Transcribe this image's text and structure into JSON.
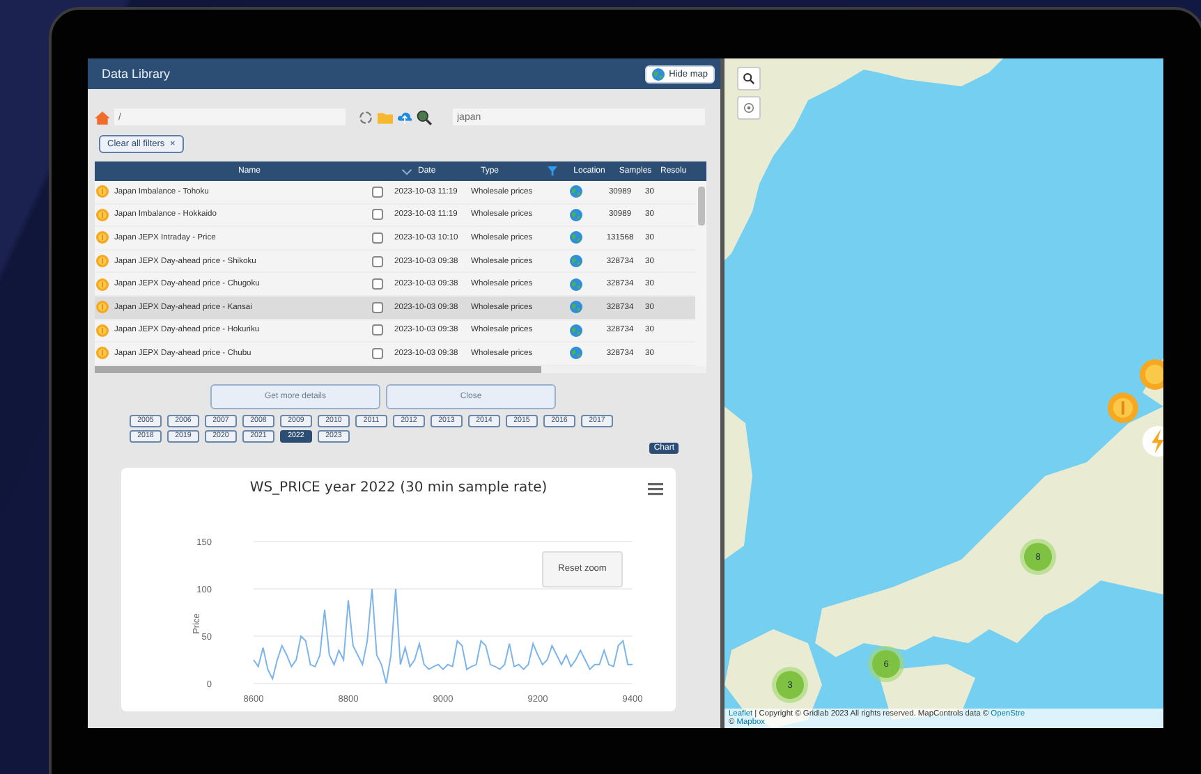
{
  "window": {
    "title": "Data Library"
  },
  "hide_map_button": {
    "label": "Hide map"
  },
  "path_field": {
    "value": "/"
  },
  "search_field": {
    "value": "japan"
  },
  "filter_chip": {
    "label": "Clear all filters",
    "close": "×"
  },
  "table": {
    "columns": [
      "Name",
      "Date",
      "Type",
      "Location",
      "Samples",
      "Resolu"
    ],
    "rows": [
      {
        "name": "Japan Imbalance - Tohoku",
        "checked": false,
        "date": "2023-10-03 11:19",
        "type": "Wholesale prices",
        "samples": "30989",
        "resolution": "30",
        "selected": false
      },
      {
        "name": "Japan Imbalance - Hokkaido",
        "checked": false,
        "date": "2023-10-03 11:19",
        "type": "Wholesale prices",
        "samples": "30989",
        "resolution": "30",
        "selected": false
      },
      {
        "name": "Japan JEPX Intraday - Price",
        "checked": false,
        "date": "2023-10-03 10:10",
        "type": "Wholesale prices",
        "samples": "131568",
        "resolution": "30",
        "selected": false
      },
      {
        "name": "Japan JEPX Day-ahead price - Shikoku",
        "checked": false,
        "date": "2023-10-03 09:38",
        "type": "Wholesale prices",
        "samples": "328734",
        "resolution": "30",
        "selected": false
      },
      {
        "name": "Japan JEPX Day-ahead price - Chugoku",
        "checked": false,
        "date": "2023-10-03 09:38",
        "type": "Wholesale prices",
        "samples": "328734",
        "resolution": "30",
        "selected": false
      },
      {
        "name": "Japan JEPX Day-ahead price - Kansai",
        "checked": false,
        "date": "2023-10-03 09:38",
        "type": "Wholesale prices",
        "samples": "328734",
        "resolution": "30",
        "selected": true
      },
      {
        "name": "Japan JEPX Day-ahead price - Hokuriku",
        "checked": false,
        "date": "2023-10-03 09:38",
        "type": "Wholesale prices",
        "samples": "328734",
        "resolution": "30",
        "selected": false
      },
      {
        "name": "Japan JEPX Day-ahead price - Chubu",
        "checked": false,
        "date": "2023-10-03 09:38",
        "type": "Wholesale prices",
        "samples": "328734",
        "resolution": "30",
        "selected": false
      }
    ]
  },
  "detail_buttons": [
    "Get more details",
    "Close"
  ],
  "years": [
    {
      "label": "2005",
      "selected": false
    },
    {
      "label": "2006",
      "selected": false
    },
    {
      "label": "2007",
      "selected": false
    },
    {
      "label": "2008",
      "selected": false
    },
    {
      "label": "2009",
      "selected": false
    },
    {
      "label": "2010",
      "selected": false
    },
    {
      "label": "2011",
      "selected": false
    },
    {
      "label": "2012",
      "selected": false
    },
    {
      "label": "2013",
      "selected": false
    },
    {
      "label": "2014",
      "selected": false
    },
    {
      "label": "2015",
      "selected": false
    },
    {
      "label": "2016",
      "selected": false
    },
    {
      "label": "2017",
      "selected": false
    },
    {
      "label": "2018",
      "selected": false
    },
    {
      "label": "2019",
      "selected": false
    },
    {
      "label": "2020",
      "selected": false
    },
    {
      "label": "2021",
      "selected": false
    },
    {
      "label": "2022",
      "selected": true
    },
    {
      "label": "2023",
      "selected": false
    }
  ],
  "chart_button": {
    "label": "Chart"
  },
  "chart": {
    "reset_zoom": "Reset zoom",
    "chart_data": {
      "type": "line",
      "title": "WS_PRICE year 2022 (30 min sample rate)",
      "ylabel": "Price",
      "xlim": [
        8600,
        9400
      ],
      "ylim": [
        0,
        150
      ],
      "xticks": [
        8600,
        8800,
        9000,
        9200,
        9400
      ],
      "yticks": [
        0,
        50,
        100,
        150
      ],
      "x": [
        8600,
        8610,
        8620,
        8630,
        8640,
        8650,
        8660,
        8670,
        8680,
        8690,
        8700,
        8710,
        8720,
        8730,
        8740,
        8750,
        8760,
        8770,
        8780,
        8790,
        8800,
        8810,
        8820,
        8830,
        8840,
        8850,
        8860,
        8870,
        8880,
        8890,
        8900,
        8910,
        8920,
        8930,
        8940,
        8950,
        8960,
        8970,
        8980,
        8990,
        9000,
        9010,
        9020,
        9030,
        9040,
        9050,
        9060,
        9070,
        9080,
        9090,
        9100,
        9110,
        9120,
        9130,
        9140,
        9150,
        9160,
        9170,
        9180,
        9190,
        9200,
        9210,
        9220,
        9230,
        9240,
        9250,
        9260,
        9270,
        9280,
        9290,
        9300,
        9310,
        9320,
        9330,
        9340,
        9350,
        9360,
        9370,
        9380,
        9390,
        9400
      ],
      "series": [
        {
          "color": "#7cb5ec",
          "values": [
            25,
            18,
            38,
            15,
            5,
            25,
            40,
            30,
            18,
            25,
            50,
            45,
            20,
            18,
            30,
            78,
            30,
            20,
            35,
            25,
            88,
            40,
            30,
            20,
            45,
            100,
            30,
            20,
            0,
            30,
            100,
            20,
            38,
            18,
            25,
            42,
            20,
            15,
            18,
            20,
            15,
            20,
            18,
            45,
            40,
            15,
            18,
            20,
            45,
            40,
            20,
            18,
            15,
            20,
            42,
            18,
            20,
            15,
            20,
            42,
            30,
            20,
            25,
            40,
            30,
            20,
            30,
            18,
            25,
            35,
            25,
            15,
            20,
            20,
            35,
            20,
            18,
            40,
            45,
            20,
            20
          ]
        }
      ]
    }
  },
  "map": {
    "clusters": [
      {
        "count": "3"
      },
      {
        "count": "6"
      },
      {
        "count": "8"
      }
    ],
    "attribution": [
      [
        {
          "kind": "link",
          "text": "Leaflet"
        },
        {
          "kind": "text",
          "text": " | Copyright © Gridlab 2023 All rights reserved. MapControls data © "
        },
        {
          "kind": "link",
          "text": "OpenStre"
        }
      ],
      [
        {
          "kind": "text",
          "text": "© "
        },
        {
          "kind": "link",
          "text": "Mapbox"
        }
      ]
    ]
  }
}
